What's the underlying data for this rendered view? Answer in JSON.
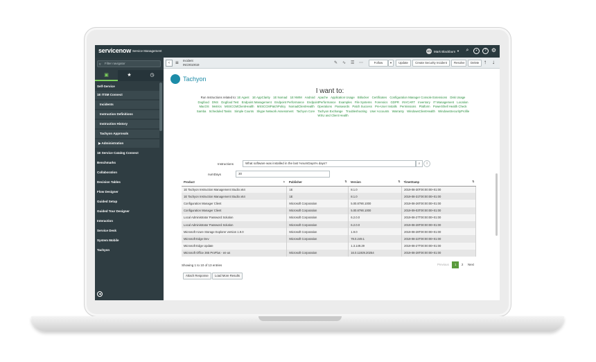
{
  "app": {
    "brand": "servicenow",
    "subtitle": "Service Management",
    "user_initials": "MB",
    "user_name": "Mark Blackburn"
  },
  "nav": {
    "filter_placeholder": "Filter navigator",
    "modules": [
      "Self-Service",
      "1E ITSM Connect",
      "Incidents",
      "Instruction Definitions",
      "Instruction History",
      "Tachyon Approvals",
      "Administration",
      "1E Service Catalog Connect",
      "Benchmarks",
      "Collaboration",
      "Decision Tables",
      "Flow Designer",
      "Guided Setup",
      "Guided Tour Designer",
      "Interaction",
      "Service Desk",
      "System Mobile",
      "Tachyon"
    ]
  },
  "form": {
    "record_type": "Incident",
    "record_number": "INC0010019",
    "buttons": [
      "Follow",
      "Update",
      "Create Security Incident",
      "Resolve",
      "Delete"
    ]
  },
  "tachyon": {
    "brand": "Tachyon",
    "heading": "I want to:",
    "instructions_lead": "Run Instructions related to:",
    "topics": [
      "1E Agent",
      "1E AppClarity",
      "1E Nomad",
      "1E NWM",
      "Android",
      "Apache",
      "Application Usage",
      "Bitlocker",
      "Certificates",
      "Configuration Manager Console Extensions",
      "Disk Usage",
      "Dogfood",
      "DNS",
      "Dogfood Test",
      "Endpoint Management",
      "Endpoint Performance",
      "EndpointPerformance",
      "Examples",
      "File Systems",
      "Forensics",
      "GDPR",
      "INVCART",
      "Inventory",
      "IT Management",
      "Location",
      "MacOS",
      "Metrics",
      "MSSCCMClientHealth",
      "MSSCCMPatchPolicy",
      "NomadClientHealth",
      "Operations",
      "Passwords",
      "Patch Success",
      "Pre-User Installs",
      "Permissions",
      "Platform",
      "PowerShell Health Check",
      "Samba",
      "Scheduled Tasks",
      "Simple Counts",
      "Skype Network Assessment",
      "Tachyon Core",
      "Tachyon Exchange",
      "Troubleshooting",
      "User Accounts",
      "Warranty",
      "WindowsClientHealth",
      "WindowsSecurityProfile",
      "WSU and Client Health"
    ],
    "instructions_label": "Instructions",
    "instructions_value": "What software was installed in the last %numDays% days?",
    "numdays_label": "numDays",
    "numdays_value": "30",
    "run_label": "Run Instruction",
    "show_label": "Show",
    "show_value": "10",
    "entries_label": "entries",
    "search_label": "Search:",
    "columns": [
      "Product",
      "Publisher",
      "Version",
      "TimeStamp"
    ],
    "rows": [
      [
        "1E Tachyon Instruction Management Studio x64",
        "1E",
        "8.1.0",
        "2019-08-30T00:00:00+01:00"
      ],
      [
        "1E Tachyon Instruction Management Studio x64",
        "1E",
        "8.1.0",
        "2019-08-31T00:00:00+01:00"
      ],
      [
        "Configuration Manager Client",
        "Microsoft Corporation",
        "5.00.8790.1000",
        "2019-08-26T00:00:00+01:00"
      ],
      [
        "Configuration Manager Client",
        "Microsoft Corporation",
        "5.00.8790.1000",
        "2019-09-03T00:00:00+01:00"
      ],
      [
        "Local Administrator Password Solution",
        "Microsoft Corporation",
        "6.2.0.0",
        "2019-08-27T00:00:00+01:00"
      ],
      [
        "Local Administrator Password Solution",
        "Microsoft Corporation",
        "6.2.0.0",
        "2019-08-28T00:00:00+01:00"
      ],
      [
        "Microsoft Azure Storage Explorer version 1.9.0",
        "Microsoft Corporation",
        "1.9.0",
        "2019-08-28T00:00:00+01:00"
      ],
      [
        "Microsoft Edge Dev",
        "Microsoft Corporation",
        "78.0.249.1",
        "2019-08-22T00:00:00+01:00"
      ],
      [
        "Microsoft Edge Update",
        "",
        "1.3.149.29",
        "2019-08-27T00:00:00+01:00"
      ],
      [
        "Microsoft Office 365 ProPlus - en-us",
        "Microsoft Corporation",
        "16.0.11929.20254",
        "2019-08-28T00:00:00+01:00"
      ]
    ],
    "showing": "Showing 1 to 10 of 13 entries",
    "pager": {
      "previous": "Previous",
      "page1": "1",
      "page2": "2",
      "next": "Next"
    },
    "attach_label": "Attach Response",
    "load_more_label": "Load More Results"
  }
}
